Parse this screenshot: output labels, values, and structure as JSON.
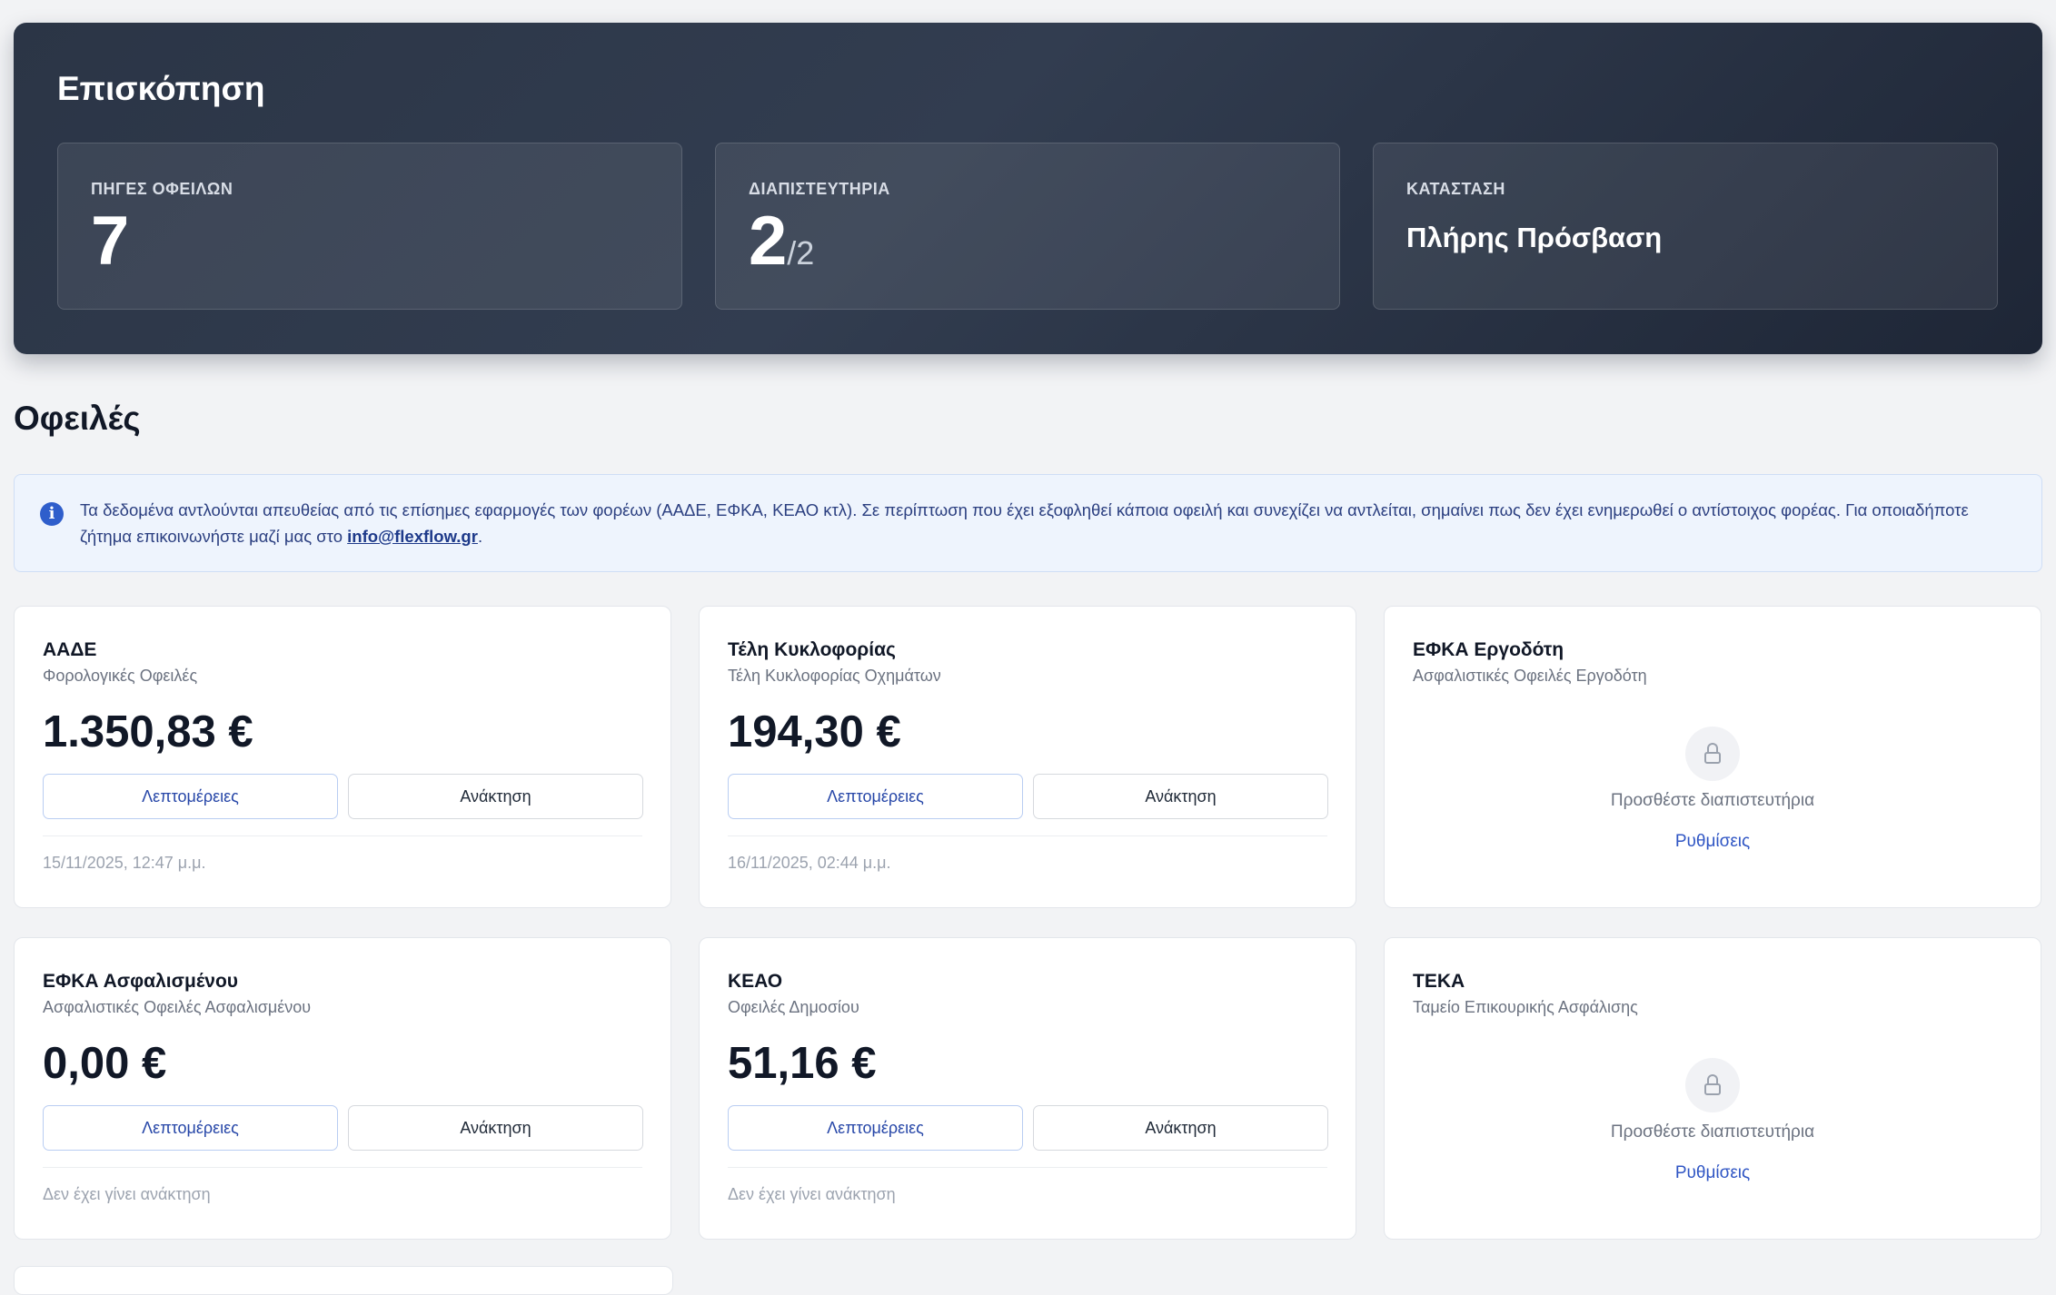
{
  "overview": {
    "title": "Επισκόπηση",
    "stats": [
      {
        "label": "ΠΗΓΕΣ ΟΦΕΙΛΩΝ",
        "value": "7"
      },
      {
        "label": "ΔΙΑΠΙΣΤΕΥΤΗΡΙΑ",
        "value": "2",
        "sub": "/2"
      },
      {
        "label": "ΚΑΤΑΣΤΑΣΗ",
        "value": "Πλήρης Πρόσβαση"
      }
    ]
  },
  "debts_section": {
    "title": "Οφειλές",
    "notice": {
      "text": "Τα δεδομένα αντλούνται απευθείας από τις επίσημες εφαρμογές των φορέων (ΑΑΔΕ, ΕΦΚΑ, ΚΕΑΟ κτλ). Σε περίπτωση που έχει εξοφληθεί κάποια οφειλή και συνεχίζει να αντλείται, σημαίνει πως δεν έχει ενημερωθεί ο αντίστοιχος φορέας. Για οποιαδήποτε ζήτημα επικοινωνήστε μαζί μας στο ",
      "email": "info@flexflow.gr",
      "suffix": "."
    },
    "buttons": {
      "details": "Λεπτομέρειες",
      "fetch": "Ανάκτηση"
    },
    "locked": {
      "text": "Προσθέστε διαπιστευτήρια",
      "link": "Ρυθμίσεις"
    },
    "cards": [
      {
        "name": "ΑΑΔΕ",
        "desc": "Φορολογικές Οφειλές",
        "amount": "1.350,83 €",
        "footer": "15/11/2025, 12:47 μ.μ."
      },
      {
        "name": "Τέλη Κυκλοφορίας",
        "desc": "Τέλη Κυκλοφορίας Οχημάτων",
        "amount": "194,30 €",
        "footer": "16/11/2025, 02:44 μ.μ."
      },
      {
        "name": "ΕΦΚΑ Εργοδότη",
        "desc": "Ασφαλιστικές Οφειλές Εργοδότη"
      },
      {
        "name": "ΕΦΚΑ Ασφαλισμένου",
        "desc": "Ασφαλιστικές Οφειλές Ασφαλισμένου",
        "amount": "0,00 €",
        "footer": "Δεν έχει γίνει ανάκτηση"
      },
      {
        "name": "ΚΕΑΟ",
        "desc": "Οφειλές Δημοσίου",
        "amount": "51,16 €",
        "footer": "Δεν έχει γίνει ανάκτηση"
      },
      {
        "name": "ΤΕΚΑ",
        "desc": "Ταμείο Επικουρικής Ασφάλισης"
      }
    ]
  },
  "colors": {
    "overview_bg": "#2b3546",
    "page_bg": "#f2f3f5",
    "accent_blue": "#3056c4",
    "notice_bg": "#eef4fd"
  },
  "icons": [
    "info-icon",
    "lock-icon"
  ]
}
